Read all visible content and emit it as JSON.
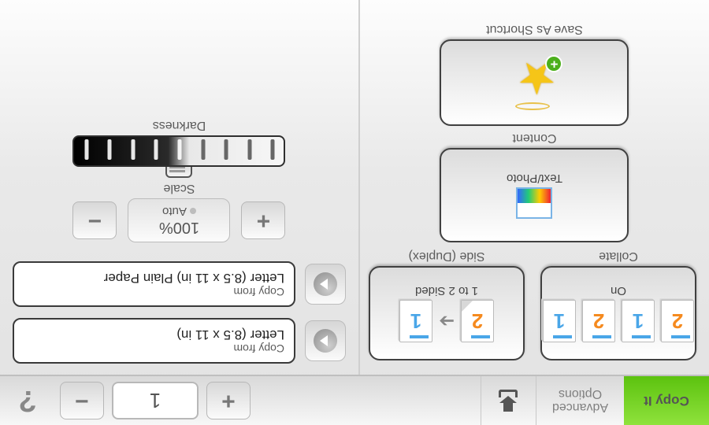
{
  "topbar": {
    "copy_it": "Copy It",
    "advanced_line1": "Advanced",
    "advanced_line2": "Options",
    "qty_value": "1",
    "help": "?"
  },
  "tiles": {
    "collate": {
      "label": "Collate",
      "value": "On"
    },
    "duplex": {
      "label": "Side (Duplex)",
      "value": "1 to 2 Sided"
    },
    "content": {
      "label": "Content",
      "value": "Text/Photo"
    },
    "shortcut": {
      "label": "Save As Shortcut"
    }
  },
  "source": {
    "copy_from": {
      "label": "Copy from",
      "value": "Letter (8.5 x 11 in)"
    },
    "copy_to": {
      "label": "Copy from",
      "value": "Letter (8.5 x 11 in) Plain Paper"
    }
  },
  "scale": {
    "label": "Scale",
    "value": "100%",
    "mode": "Auto"
  },
  "darkness": {
    "label": "Darkness"
  },
  "glyph": {
    "plus": "+",
    "minus": "−",
    "star": "★",
    "arrow": "➔"
  },
  "page_numbers": {
    "one": "1",
    "two": "2"
  },
  "colors": {
    "accent_green": "#6bcf1f",
    "orange": "#f58a1f",
    "blue": "#4aa6e8"
  }
}
